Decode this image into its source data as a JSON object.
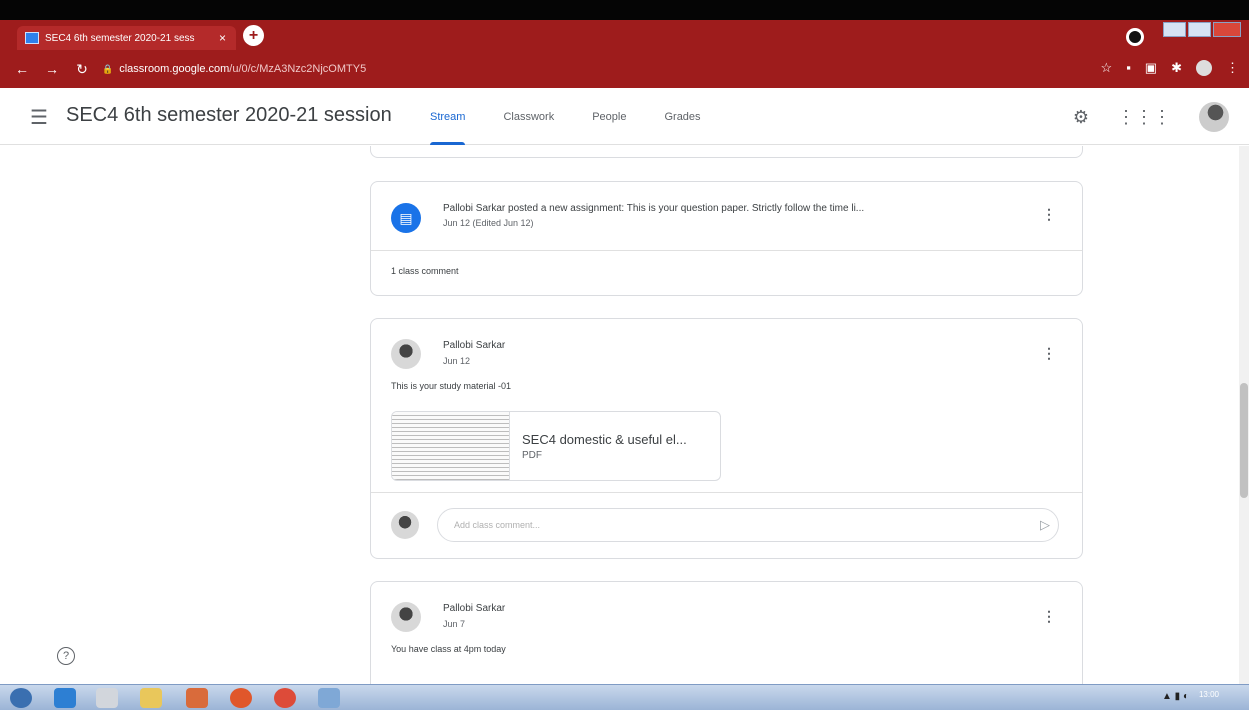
{
  "browser": {
    "tab_title": "SEC4 6th semester 2020-21 sess",
    "tab_close": "×",
    "new_tab": "+",
    "url_host": "classroom.google.com",
    "url_path": "/u/0/c/MzA3Nzc2NjcOMTY5"
  },
  "header": {
    "class_title": "SEC4 6th semester 2020-21 session",
    "tabs": [
      {
        "label": "Stream",
        "active": true
      },
      {
        "label": "Classwork",
        "active": false
      },
      {
        "label": "People",
        "active": false
      },
      {
        "label": "Grades",
        "active": false
      }
    ]
  },
  "posts": [
    {
      "type": "assignment",
      "title": "Pallobi Sarkar posted a new assignment: This is your question paper. Strictly follow the time li...",
      "date": "Jun 12 (Edited Jun 12)",
      "comment_count": "1 class comment"
    },
    {
      "type": "material",
      "author": "Pallobi Sarkar",
      "date": "Jun 12",
      "body": "This is your study material -01",
      "attachment_name": "SEC4 domestic & useful el...",
      "attachment_type": "PDF",
      "comment_placeholder": "Add class comment..."
    },
    {
      "type": "announcement",
      "author": "Pallobi Sarkar",
      "date": "Jun 7",
      "body": "You have class at 4pm today"
    }
  ],
  "taskbar": {
    "clock": "13:00"
  },
  "colors": {
    "browser_chrome": "#9e1c1c",
    "accent": "#1967d2",
    "assignment_icon": "#1a73e8"
  }
}
